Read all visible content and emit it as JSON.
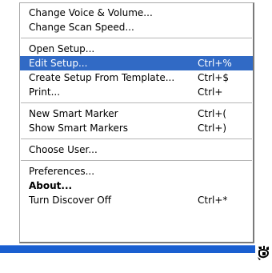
{
  "menu": {
    "groups": [
      [
        {
          "label": "Change Voice & Volume...",
          "shortcut": ""
        },
        {
          "label": "Change Scan Speed...",
          "shortcut": ""
        }
      ],
      [
        {
          "label": "Open Setup...",
          "shortcut": ""
        },
        {
          "label": "Edit Setup...",
          "shortcut": "Ctrl+%"
        },
        {
          "label": "Create Setup From Template...",
          "shortcut": "Ctrl+$"
        },
        {
          "label": "Print...",
          "shortcut": "Ctrl+"
        }
      ],
      [
        {
          "label": "New Smart Marker",
          "shortcut": "Ctrl+("
        },
        {
          "label": "Show Smart Markers",
          "shortcut": "Ctrl+)"
        }
      ],
      [
        {
          "label": "Choose User...",
          "shortcut": ""
        }
      ],
      [
        {
          "label": "Preferences...",
          "shortcut": ""
        },
        {
          "label": "About...",
          "shortcut": ""
        },
        {
          "label": "Turn Discover Off",
          "shortcut": "Ctrl+*"
        }
      ]
    ],
    "highlighted_item": "Edit Setup...",
    "highlight_color": "#316ac5",
    "taskbar_color": "#1a5fd0"
  },
  "tray": {
    "icon": "discover-tray-icon"
  }
}
